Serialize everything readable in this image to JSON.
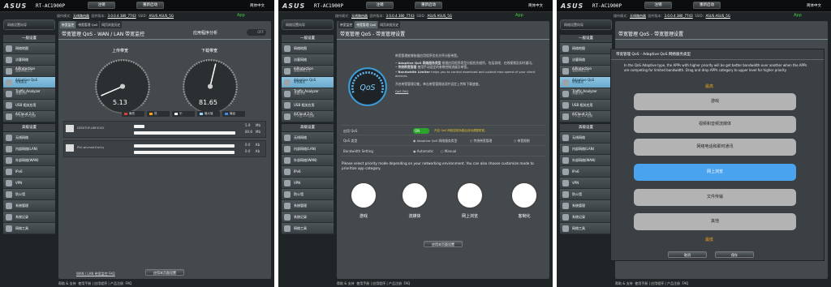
{
  "common": {
    "logo": "ASUS",
    "model": "RT-AC1900P",
    "logout": "注销",
    "reboot": "重新启动",
    "lang": "简体中文",
    "op_mode_label": "操作模式：",
    "op_mode": "无线路由器",
    "fw_label": "固件版本：",
    "fw": "3.0.0.4.380_7743",
    "ssid_label": "SSID：",
    "ssid": "ASUS ASUS_5G",
    "app": "App",
    "wizard": "网络设置向导",
    "general": "一般设置",
    "advanced": "高级设置",
    "menu_general": [
      "网络地图",
      "访客网络",
      "AiProtection",
      "智能网络卫士",
      "Adaptive QoS",
      "带宽监控",
      "Traffic Analyzer",
      "流量分析",
      "USB 相关应用",
      "AiCloud 2.0",
      "个人云 2.0 应用"
    ],
    "menu_advanced": [
      "无线网络",
      "内部网络(LAN)",
      "外部网络(WAN)",
      "IPv6",
      "VPN",
      "防火墙",
      "系统管理",
      "系统记录",
      "网络工具"
    ],
    "footer_help": "帮助 & 支持",
    "footer_links": "使用手册 | 应用程序 | 产品注册",
    "footer_faq": "FAQ"
  },
  "p1": {
    "tabs": [
      "带宽监控",
      "带宽管理 QoS",
      "网页浏览历史"
    ],
    "title": "带宽管理 QoS - WAN / LAN 带宽监控",
    "app_analysis": "应用程序分析",
    "toggle": "OFF",
    "upload_label": "上传带宽",
    "download_label": "下载带宽",
    "upload_value": "5.13",
    "download_value": "81.65",
    "upload_fraction": 0.08,
    "download_fraction": 0.55,
    "legend": [
      "最低",
      "低",
      "中",
      "最大值",
      "最高"
    ],
    "legend_colors": [
      "#e23b2f",
      "#f2a51b",
      "#f6f6f6",
      "#9ad0f5",
      "#3f8bf0"
    ],
    "clients": [
      {
        "name": "DESKTOP-ABF4OS5",
        "up": "5.9",
        "down": "80.8",
        "unit": "Mb",
        "up_fraction": 0.1,
        "down_fraction": 0.95
      },
      {
        "name": "Phil-wivmod1hsi1q",
        "up": "0.0",
        "down": "0.0",
        "unit": "Kb",
        "up_fraction": 0.94,
        "down_fraction": 0.94
      }
    ],
    "wan_lan_faq": "WAN / LAN 带宽监控 FAQ",
    "apply": "应用本页面设置"
  },
  "p2": {
    "tabs": [
      "带宽监控",
      "带宽管理 QoS",
      "网页浏览历史"
    ],
    "title": "带宽管理 QoS - 带宽管理设置",
    "intro": "带宽管理能够依据应用程序优先次序分配带宽。",
    "bullets": [
      {
        "bold": "Adaptive QoS 网络服务类型",
        "text": "根据应用程序类型分配优先顺序，包括游戏、在线视频及实时通讯。"
      },
      {
        "bold": "传统带宽管理",
        "text": "使用手动设定的参数控制流量及带宽。"
      },
      {
        "bold": "Bandwidth Limiter",
        "text": "helps you to control download and upload max speed of your client devices."
      }
    ],
    "note": "开启带宽管理功能，单击带宽管理选项并设定上传和下载速度。",
    "faq": "QoS FAQ",
    "gauge_text": "QoS",
    "enable_label": "启用 QoS",
    "enable_value": "ON",
    "enable_hint": "开启 QoS 网络控制功能后自动调整带宽。",
    "qos_type_label": "QoS 类型",
    "qos_types": [
      "Adaptive QoS 网络服务类型",
      "传统带宽管理",
      "带宽限制"
    ],
    "bw_label": "Bandwidth Setting",
    "bw_options": [
      "Automatic",
      "Manual"
    ],
    "select_prompt": "Please select priority mode depending on your networking environment. You can also choose customize mode to prioritize app category.",
    "categories": [
      "游戏",
      "流媒体",
      "网上浏览",
      "客制化"
    ],
    "apply": "应用本页面设置"
  },
  "p3": {
    "title": "带宽管理 QoS - 带宽管理设置",
    "dialog_title": "带宽管理 QoS - Adaptive QoS 网络服务类型",
    "dialog_text": "In the QoS Adaptive type, the APPs with higher priority will be get better bandwidth over another when the APPs are competing for limited bandwidth. Drag and drop APPs category to upper level for higher priority",
    "highest": "最高",
    "lowest": "最低",
    "priorities": [
      "游戏",
      "视频和音频流媒体",
      "网络电话和即时通讯",
      "网上浏览",
      "文件传输",
      "其他"
    ],
    "cancel": "取消",
    "save": "保存"
  }
}
